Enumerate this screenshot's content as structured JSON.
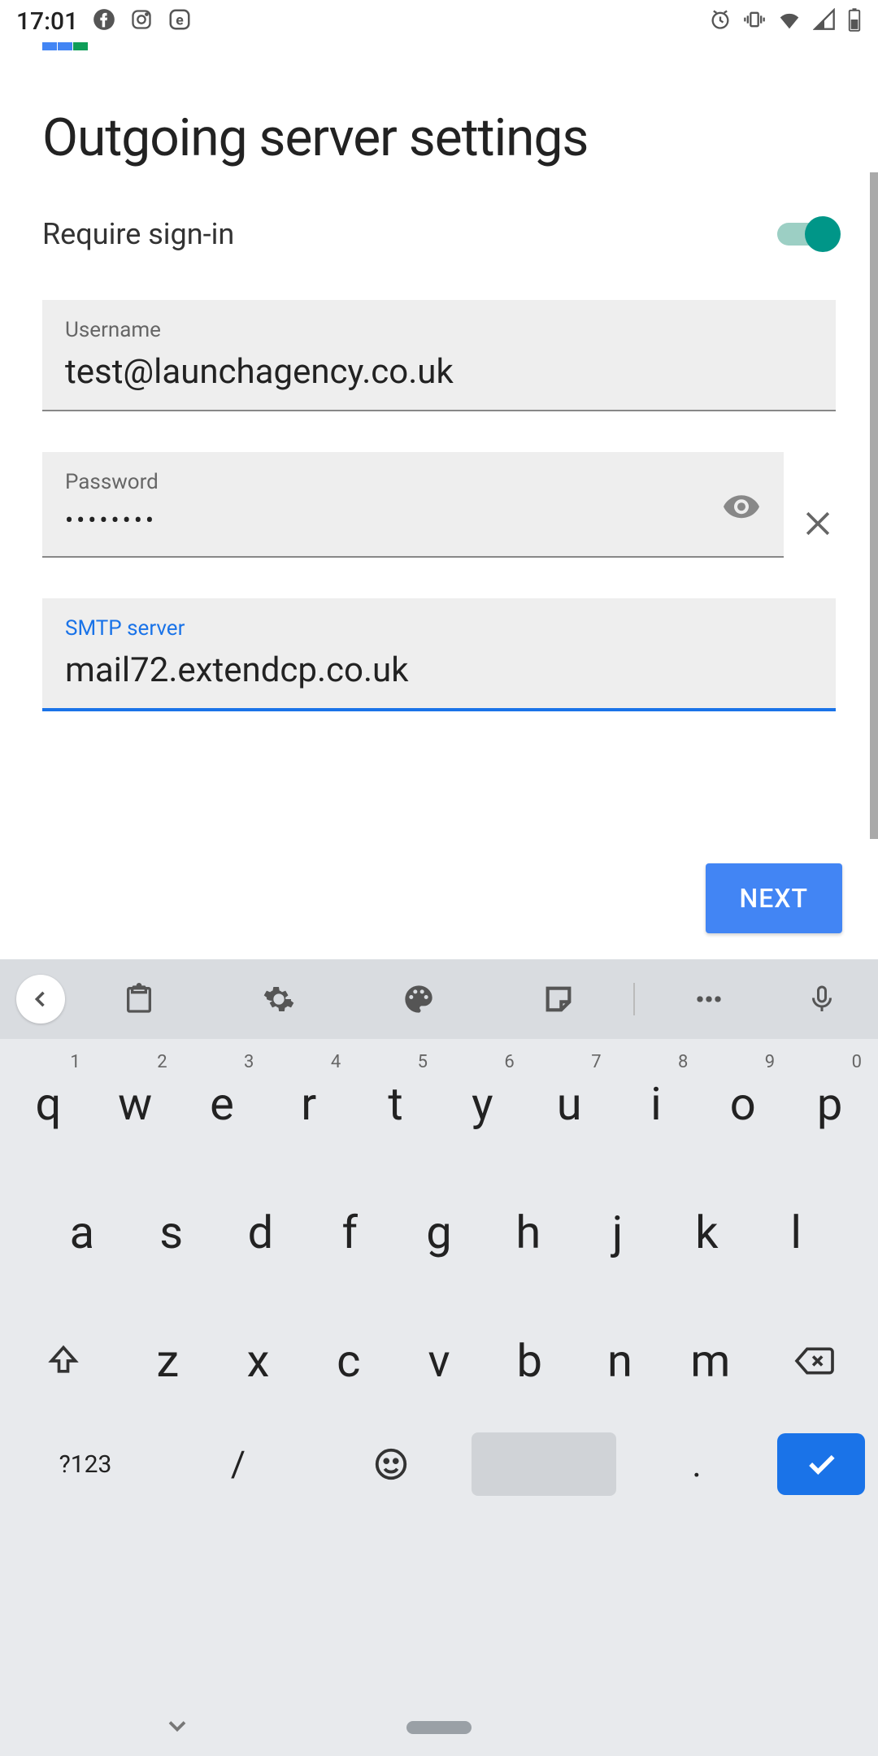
{
  "status": {
    "time": "17:01"
  },
  "page": {
    "title": "Outgoing server settings"
  },
  "toggle": {
    "label": "Require sign-in",
    "value": true
  },
  "fields": {
    "username": {
      "label": "Username",
      "value": "test@launchagency.co.uk"
    },
    "password": {
      "label": "Password",
      "value": "••••••••"
    },
    "smtp": {
      "label": "SMTP server",
      "value": "mail72.extendcp.co.uk"
    }
  },
  "buttons": {
    "next": "NEXT"
  },
  "keyboard": {
    "row1": [
      {
        "k": "q",
        "h": "1"
      },
      {
        "k": "w",
        "h": "2"
      },
      {
        "k": "e",
        "h": "3"
      },
      {
        "k": "r",
        "h": "4"
      },
      {
        "k": "t",
        "h": "5"
      },
      {
        "k": "y",
        "h": "6"
      },
      {
        "k": "u",
        "h": "7"
      },
      {
        "k": "i",
        "h": "8"
      },
      {
        "k": "o",
        "h": "9"
      },
      {
        "k": "p",
        "h": "0"
      }
    ],
    "row2": [
      "a",
      "s",
      "d",
      "f",
      "g",
      "h",
      "j",
      "k",
      "l"
    ],
    "row3": [
      "z",
      "x",
      "c",
      "v",
      "b",
      "n",
      "m"
    ],
    "mode": "?123",
    "slash": "/",
    "dot": "."
  }
}
